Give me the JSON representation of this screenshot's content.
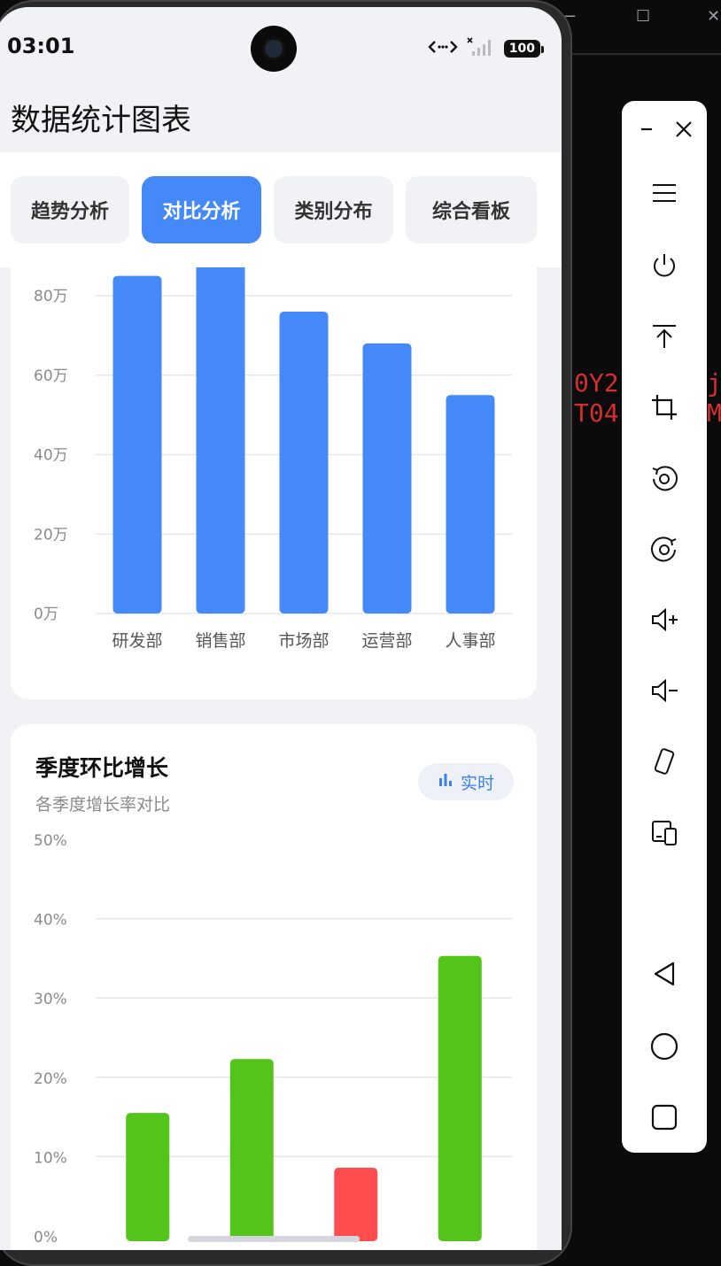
{
  "status": {
    "time": "03:01",
    "battery": "100"
  },
  "page": {
    "title": "数据统计图表"
  },
  "tabs": [
    {
      "label": "趋势分析",
      "active": false
    },
    {
      "label": "对比分析",
      "active": true
    },
    {
      "label": "类别分布",
      "active": false
    },
    {
      "label": "综合看板",
      "active": false
    }
  ],
  "chart_data": [
    {
      "type": "bar",
      "title": "",
      "categories": [
        "研发部",
        "销售部",
        "市场部",
        "运营部",
        "人事部"
      ],
      "values": [
        85,
        90,
        76,
        68,
        55
      ],
      "ytick_labels": [
        "0万",
        "20万",
        "40万",
        "60万",
        "80万"
      ],
      "ylim": [
        0,
        80
      ],
      "color": "#4589f9",
      "grid": true
    },
    {
      "type": "bar",
      "title": "季度环比增长",
      "subtitle": "各季度增长率对比",
      "badge": "实时",
      "values": [
        15.5,
        22.3,
        8.6,
        35.3
      ],
      "bar_colors": [
        "#52c41a",
        "#52c41a",
        "#ff4d4f",
        "#52c41a"
      ],
      "ytick_labels": [
        "0%",
        "10%",
        "20%",
        "30%",
        "40%",
        "50%"
      ],
      "ylim": [
        0,
        50
      ],
      "grid": true
    }
  ],
  "background": {
    "terminal_text_1": "0Y2",
    "terminal_text_2": "T04",
    "terminal_text_3": "j",
    "terminal_text_4": "M"
  },
  "toolbar": {
    "items": [
      "minimize-icon",
      "close-icon",
      "menu-icon",
      "power-icon",
      "upload-icon",
      "crop-icon",
      "rotate-left-icon",
      "rotate-right-icon",
      "volume-up-icon",
      "volume-down-icon",
      "shake-icon",
      "device-icon",
      "back-icon",
      "home-icon",
      "recents-icon"
    ]
  }
}
